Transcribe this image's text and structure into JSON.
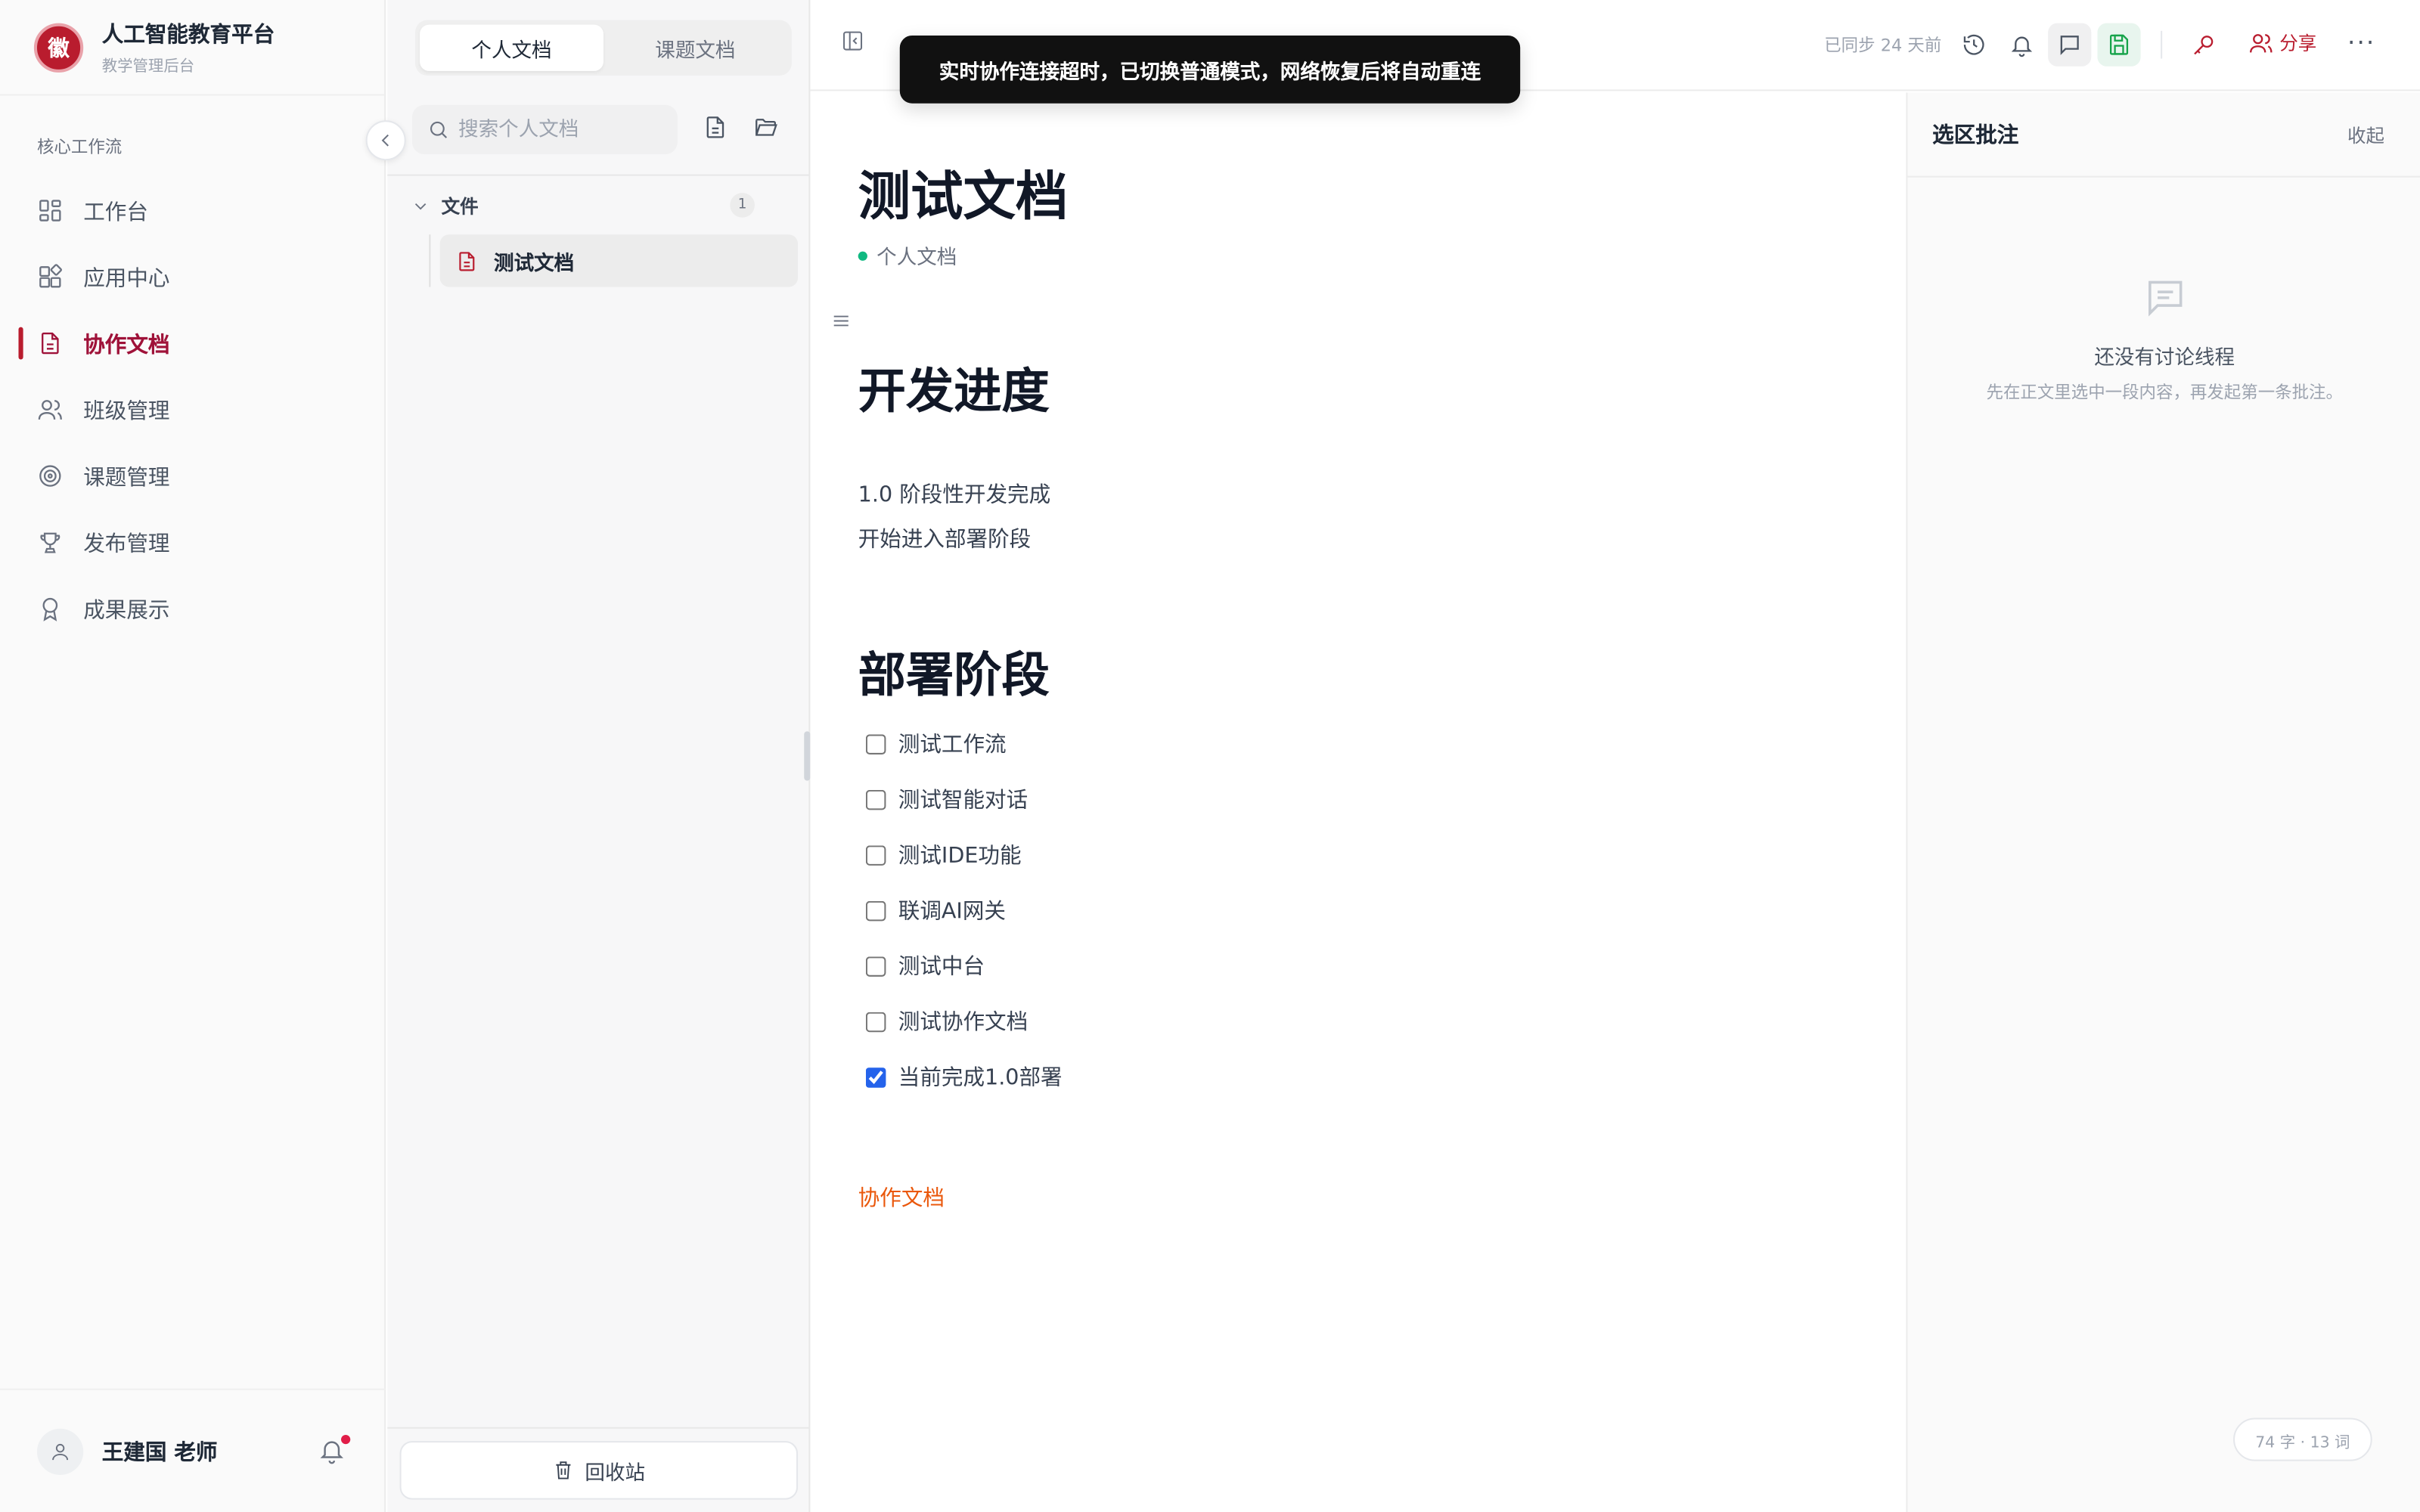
{
  "brand": {
    "title": "人工智能教育平台",
    "subtitle": "教学管理后台",
    "logo_glyph": "徽"
  },
  "sidebar": {
    "section_label": "核心工作流",
    "items": [
      {
        "label": "工作台",
        "icon": "dashboard-icon"
      },
      {
        "label": "应用中心",
        "icon": "apps-icon"
      },
      {
        "label": "协作文档",
        "icon": "document-icon",
        "active": true
      },
      {
        "label": "班级管理",
        "icon": "users-icon"
      },
      {
        "label": "课题管理",
        "icon": "target-icon"
      },
      {
        "label": "发布管理",
        "icon": "trophy-icon"
      },
      {
        "label": "成果展示",
        "icon": "award-icon"
      }
    ],
    "user_name": "王建国 老师"
  },
  "doclist": {
    "tabs": [
      {
        "label": "个人文档",
        "active": true
      },
      {
        "label": "课题文档"
      }
    ],
    "search_placeholder": "搜索个人文档",
    "folder": {
      "name": "文件",
      "count": "1"
    },
    "files": [
      {
        "name": "测试文档",
        "selected": true
      }
    ],
    "trash_label": "回收站"
  },
  "topbar": {
    "toast": "实时协作连接超时，已切换普通模式，网络恢复后将自动重连",
    "sync_status": "已同步 24 天前",
    "share_label": "分享",
    "more_label": "···"
  },
  "document": {
    "title": "测试文档",
    "meta": "个人文档",
    "sections": [
      {
        "heading": "开发进度",
        "paragraphs": [
          "1.0 阶段性开发完成",
          "开始进入部署阶段"
        ]
      },
      {
        "heading": "部署阶段"
      }
    ],
    "tasks": [
      {
        "label": "测试工作流",
        "checked": false
      },
      {
        "label": "测试智能对话",
        "checked": false
      },
      {
        "label": "测试IDE功能",
        "checked": false
      },
      {
        "label": "联调AI网关",
        "checked": false
      },
      {
        "label": "测试中台",
        "checked": false
      },
      {
        "label": "测试协作文档",
        "checked": false
      },
      {
        "label": "当前完成1.0部署",
        "checked": true
      }
    ],
    "link_text": "协作文档"
  },
  "comments": {
    "title": "选区批注",
    "collapse_label": "收起",
    "empty_title": "还没有讨论线程",
    "empty_subtitle": "先在正文里选中一段内容，再发起第一条批注。",
    "word_count": "74 字 · 13 词"
  },
  "colors": {
    "brand": "#b91c2e",
    "link": "#ea580c",
    "status_dot": "#10b981",
    "save_green": "#16a34a"
  }
}
